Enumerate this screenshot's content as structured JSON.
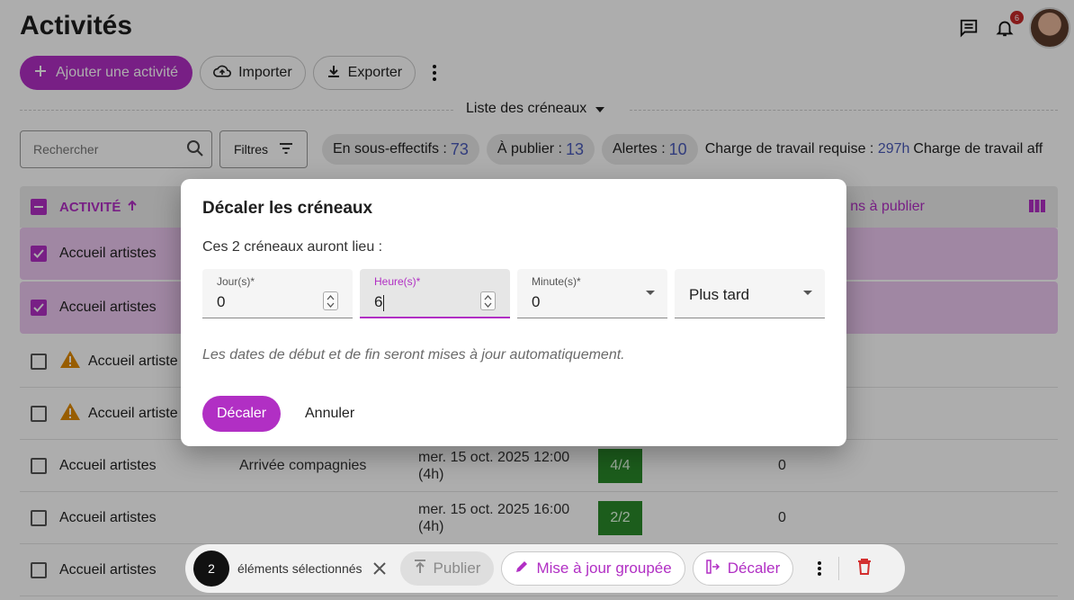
{
  "page": {
    "title": "Activités"
  },
  "topbar": {
    "notification_count": "6"
  },
  "toolbar": {
    "add_label": "Ajouter une activité",
    "import_label": "Importer",
    "export_label": "Exporter"
  },
  "view": {
    "selected": "Liste des créneaux"
  },
  "search": {
    "placeholder": "Rechercher"
  },
  "filters": {
    "label": "Filtres"
  },
  "stats": {
    "understaffed_label": "En sous-effectifs :",
    "understaffed_value": "73",
    "to_publish_label": "À publier :",
    "to_publish_value": "13",
    "alerts_label": "Alertes :",
    "alerts_value": "10",
    "required_load_label": "Charge de travail requise :",
    "required_load_value": "297h",
    "assigned_load_label": "Charge de travail aff"
  },
  "table": {
    "header_activity": "ACTIVITÉ",
    "header_right": "ns à publier",
    "rows": [
      {
        "activity": "Accueil artistes",
        "category": "",
        "date": "",
        "ratio": "",
        "zero": ""
      },
      {
        "activity": "Accueil artistes",
        "category": "",
        "date": "",
        "ratio": "",
        "zero": ""
      },
      {
        "activity": "Accueil artiste",
        "category": "",
        "date": "",
        "ratio": "",
        "zero": ""
      },
      {
        "activity": "Accueil artiste",
        "category": "",
        "date": "",
        "ratio": "",
        "zero": ""
      },
      {
        "activity": "Accueil artistes",
        "category": "Arrivée compagnies",
        "date": "mer. 15 oct. 2025 12:00 (4h)",
        "ratio": "4/4",
        "zero": "0"
      },
      {
        "activity": "Accueil artistes",
        "category": "",
        "date": "mer. 15 oct. 2025 16:00 (4h)",
        "ratio": "2/2",
        "zero": "0"
      },
      {
        "activity": "Accueil artistes",
        "category": "",
        "date": "",
        "ratio": "",
        "zero": ""
      }
    ]
  },
  "dialog": {
    "title": "Décaler les créneaux",
    "subtitle": "Ces 2 créneaux auront lieu :",
    "days_label": "Jour(s)*",
    "days_value": "0",
    "hours_label": "Heure(s)*",
    "hours_value": "6",
    "minutes_label": "Minute(s)*",
    "minutes_value": "0",
    "direction_value": "Plus tard",
    "note": "Les dates de début et de fin seront mises à jour automatiquement.",
    "confirm_label": "Décaler",
    "cancel_label": "Annuler"
  },
  "bulk": {
    "count": "2",
    "label": "éléments sélectionnés",
    "publish_label": "Publier",
    "group_update_label": "Mise à jour groupée",
    "shift_label": "Décaler"
  },
  "colors": {
    "accent": "#b12fc4",
    "stat_number": "#4a5ab8",
    "ratio_green": "#2a8a2a",
    "warning": "#e08a00",
    "delete": "#d32f2f"
  }
}
